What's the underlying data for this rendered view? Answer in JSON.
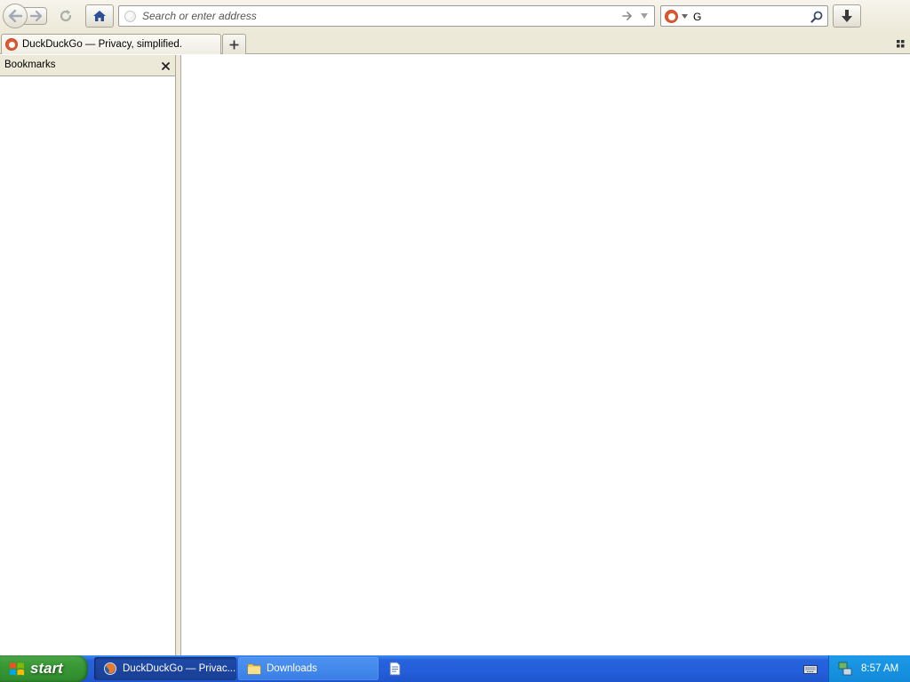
{
  "toolbar": {
    "url_placeholder": "Search or enter address",
    "search_value": "G",
    "icons": {
      "back": "back-arrow-icon",
      "forward": "forward-arrow-icon",
      "reload": "reload-icon",
      "home": "home-icon",
      "go": "go-arrow-icon",
      "history_dropdown": "dropdown-triangle-icon",
      "search": "magnifier-icon",
      "downloads": "download-arrow-icon"
    }
  },
  "tabs": [
    {
      "title": "DuckDuckGo — Privacy, simplified.",
      "icon": "duckduckgo-favicon",
      "active": true
    }
  ],
  "sidebar": {
    "title": "Bookmarks"
  },
  "taskbar": {
    "start_label": "start",
    "buttons": [
      {
        "label": "DuckDuckGo — Privac...",
        "icon": "firefox-icon",
        "active": true
      },
      {
        "label": "Downloads",
        "icon": "folder-icon",
        "active": false
      }
    ],
    "quick_launch_icon": "document-icon",
    "tray_icons": [
      "keyboard-icon",
      "network-icon"
    ],
    "clock": "8:57 AM"
  },
  "colors": {
    "chrome_bg": "#ece9d8",
    "taskbar_blue": "#245edb",
    "start_green": "#3a9b37",
    "tray_blue": "#128ad9",
    "ddg_orange": "#de5833",
    "home_blue": "#2c4f95"
  }
}
